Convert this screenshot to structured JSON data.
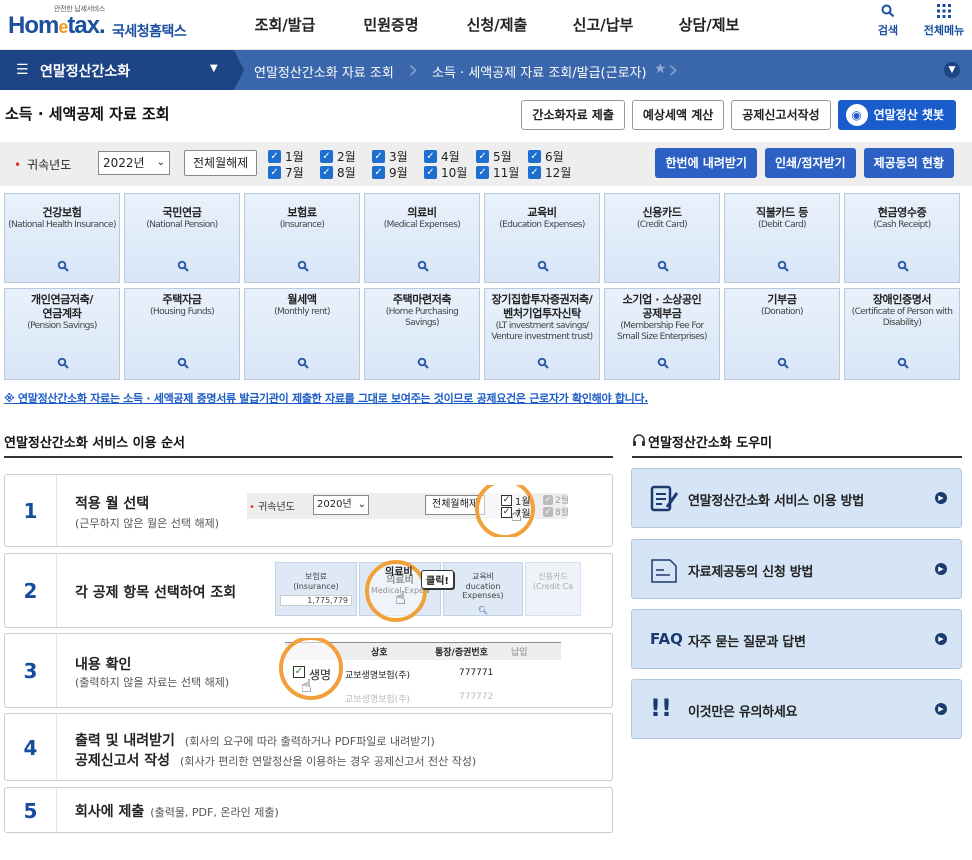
{
  "header": {
    "logo_tag": "안전한 납세서비스",
    "logo_brand_a": "Hom",
    "logo_brand_e": "e",
    "logo_brand_b": "tax.",
    "logo_kor": "국세청홈택스",
    "gnb": [
      "조회/발급",
      "민원증명",
      "신청/제출",
      "신고/납부",
      "상담/제보"
    ],
    "search_label": "검색",
    "allmenu_label": "전체메뉴"
  },
  "subnav": {
    "title": "연말정산간소화",
    "crumb1": "연말정산간소화 자료 조회",
    "crumb2": "소득 · 세액공제 자료 조회/발급(근로자)"
  },
  "page": {
    "title": "소득 · 세액공제 자료 조회",
    "buttons": [
      "간소화자료 제출",
      "예상세액 계산",
      "공제신고서작성"
    ],
    "chatbot": "연말정산 챗봇"
  },
  "filter": {
    "year_label": "귀속년도",
    "year_value": "2022년",
    "clear_label": "전체월해제",
    "months": [
      "1월",
      "2월",
      "3월",
      "4월",
      "5월",
      "6월",
      "7월",
      "8월",
      "9월",
      "10월",
      "11월",
      "12월"
    ],
    "actions": [
      "한번에 내려받기",
      "인쇄/점자받기",
      "제공동의 현황"
    ]
  },
  "tiles": [
    {
      "name": "건강보험",
      "eng": "(National Health Insurance)"
    },
    {
      "name": "국민연금",
      "eng": "(National Pension)"
    },
    {
      "name": "보험료",
      "eng": "(Insurance)"
    },
    {
      "name": "의료비",
      "eng": "(Medical Expenses)"
    },
    {
      "name": "교육비",
      "eng": "(Education Expenses)"
    },
    {
      "name": "신용카드",
      "eng": "(Credit Card)"
    },
    {
      "name": "직불카드 등",
      "eng": "(Debit Card)"
    },
    {
      "name": "현금영수증",
      "eng": "(Cash Receipt)"
    },
    {
      "name": "개인연금저축/\n연금계좌",
      "eng": "(Pension Savings)"
    },
    {
      "name": "주택자금",
      "eng": "(Housing Funds)"
    },
    {
      "name": "월세액",
      "eng": "(Monthly rent)"
    },
    {
      "name": "주택마련저축",
      "eng": "(Home Purchasing Savings)"
    },
    {
      "name": "장기집합투자증권저축/\n벤처기업투자신탁",
      "eng": "(LT investment savings/\nVenture investment trust)"
    },
    {
      "name": "소기업 · 소상공인\n공제부금",
      "eng": "(Membership Fee For\nSmall Size Enterprises)"
    },
    {
      "name": "기부금",
      "eng": "(Donation)"
    },
    {
      "name": "장애인증명서",
      "eng": "(Certificate of Person with Disability)"
    }
  ],
  "notice": "※ 연말정산간소화 자료는 소득 · 세액공제 증명서류 발급기관이 제출한 자료를 그대로 보여주는 것이므로 공제요건은 근로자가 확인해야 합니다.",
  "steps_title": "연말정산간소화 서비스 이용 순서",
  "steps": [
    {
      "num": "1",
      "title": "적용 월 선택",
      "sub": "(근무하지 않은 월은 선택 해제)"
    },
    {
      "num": "2",
      "title": "각 공제 항목 선택하여 조회",
      "sub": ""
    },
    {
      "num": "3",
      "title": "내용 확인",
      "sub": "(출력하지 않을 자료는 선택 해제)"
    },
    {
      "num": "4",
      "title": "출력 및 내려받기",
      "title_side": "(회사의 요구에 따라 출력하거나 PDF파일로 내려받기)",
      "title2": "공제신고서 작성",
      "title2_side": "(회사가 편리한 연말정산을 이용하는 경우 공제신고서 전산 작성)"
    },
    {
      "num": "5",
      "title": "회사에 제출",
      "title_side": "(출력물, PDF, 온라인 제출)"
    }
  ],
  "mock1": {
    "year_label": "귀속년도",
    "year_value": "2020년",
    "clear_label": "전체월해제",
    "m1": "1월",
    "m2": "2월",
    "m7": "7월",
    "m8": "8월"
  },
  "mock2": {
    "t1": "보험료",
    "t1e": "(Insurance)",
    "t1v": "1,775,779",
    "t2": "의료비",
    "t2e": "Medical Expen",
    "t3": "교육비",
    "t3e": "ducation Expenses)",
    "t4": "신용카드",
    "t4e": "(Credit Ca",
    "click": "클릭!"
  },
  "mock3": {
    "h1": "상호",
    "h2": "통장/증권번호",
    "h3": "납입",
    "r1": "생명",
    "r1b": "교보생명보험(주)",
    "r1c": "777771",
    "r2": "교보생명보험(주)",
    "r2c": "777772"
  },
  "helper": {
    "title": "연말정산간소화 도우미",
    "items": [
      {
        "label": "연말정산간소화 서비스 이용 방법"
      },
      {
        "label": "자료제공동의 신청 방법"
      },
      {
        "label": "자주 묻는 질문과 답변",
        "badge": "FAQ"
      },
      {
        "label": "이것만은 유의하세요",
        "badge": "!!"
      }
    ]
  }
}
